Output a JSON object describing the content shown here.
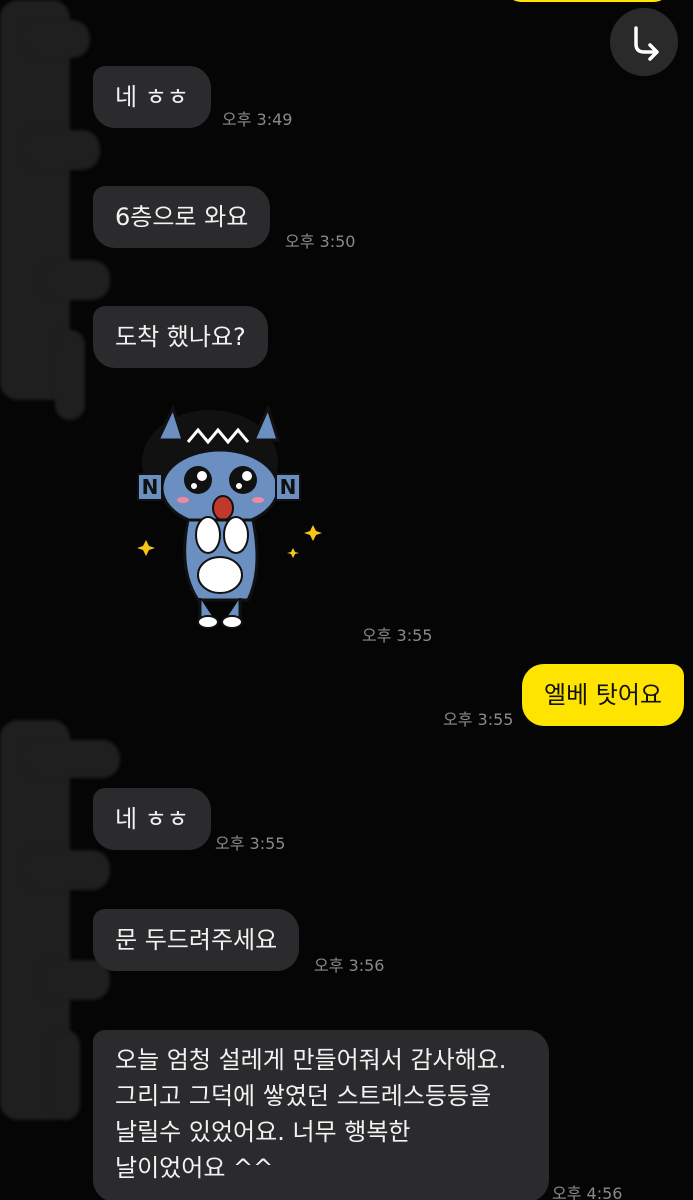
{
  "messages": [
    {
      "text": "네 ㅎㅎ",
      "time": "오후 3:49"
    },
    {
      "text": "6층으로 와요",
      "time": "오후 3:50"
    },
    {
      "text": "도착 했나요?"
    },
    {
      "time": "오후 3:55",
      "sticker": "kakao-neo-character"
    },
    {
      "text": "엘베 탓어요",
      "time": "오후 3:55"
    },
    {
      "text": "네 ㅎㅎ",
      "time": "오후 3:55"
    },
    {
      "text": "문 두드려주세요",
      "time": "오후 3:56"
    },
    {
      "lines": [
        "오늘 엄청 설레게 만들어줘서 감사해요.",
        "그리고 그덕에 쌓였던 스트레스등등을",
        "날릴수 있었어요. 너무 행복한",
        "날이었어요 ^^"
      ],
      "time": "오후 4:56"
    }
  ],
  "sticker_letters": {
    "left": "N",
    "right": "N"
  },
  "colors": {
    "background": "#050505",
    "incoming_bubble": "#2b2b2d",
    "outgoing_bubble": "#ffe400",
    "timestamp": "#8a8a8a",
    "scribble": "#1f1f1f"
  },
  "icons": {
    "forward": "share-forward-icon"
  }
}
